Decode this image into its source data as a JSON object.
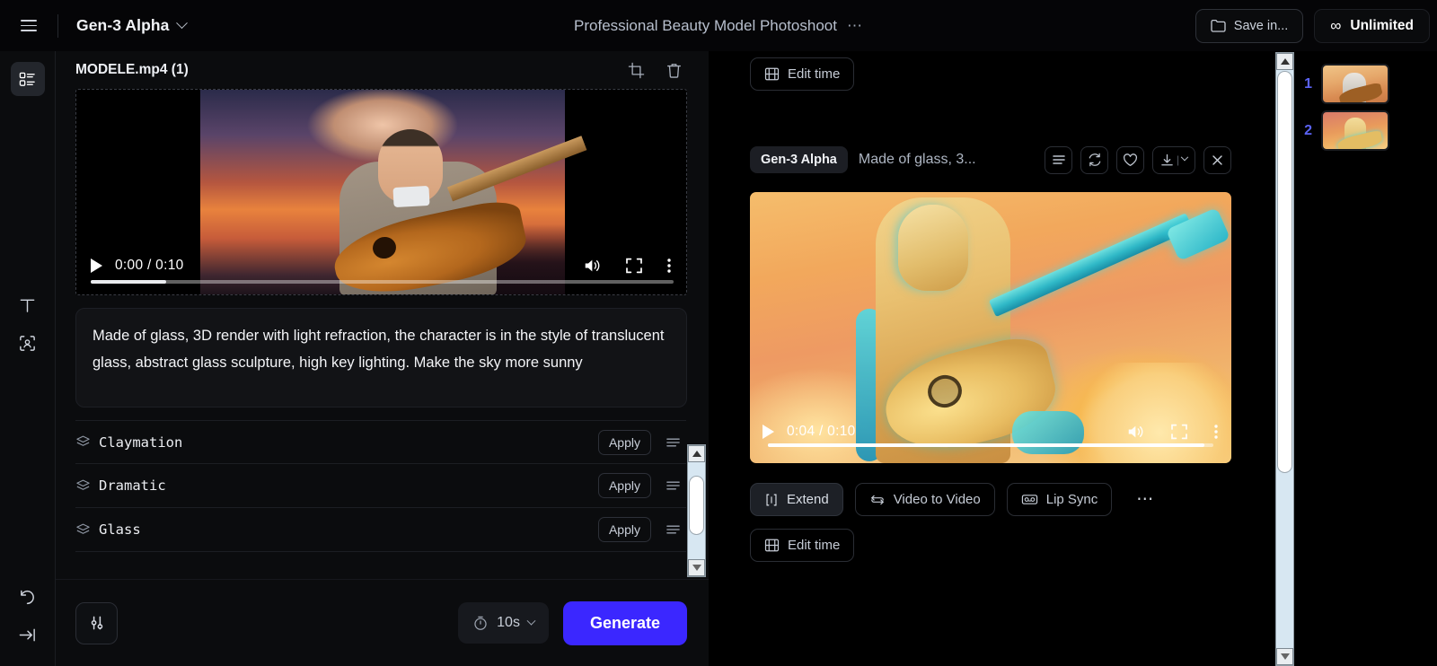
{
  "topbar": {
    "menu_icon": "hamburger-icon",
    "model_name": "Gen-3 Alpha",
    "project_title": "Professional Beauty Model Photoshoot",
    "project_more": "⋯",
    "save_in_label": "Save in...",
    "plan_label": "Unlimited",
    "plan_icon": "infinity-icon"
  },
  "rail": {
    "items": [
      {
        "name": "assets-panel",
        "icon": "list-grid-icon"
      },
      {
        "name": "text-tool",
        "icon": "text-T-icon"
      },
      {
        "name": "face-detect-tool",
        "icon": "face-scan-icon"
      },
      {
        "name": "history",
        "icon": "undo-rotate-icon"
      },
      {
        "name": "collapse-panel",
        "icon": "arrow-to-line-icon"
      }
    ]
  },
  "left_panel": {
    "asset_title": "MODELE.mp4 (1)",
    "crop_icon": "crop-icon",
    "delete_icon": "trash-icon",
    "video": {
      "current_time": "0:00",
      "duration": "0:10",
      "time_display": "0:00 / 0:10",
      "progress_percent": 13,
      "play_icon": "play-icon",
      "volume_icon": "volume-icon",
      "fullscreen_icon": "fullscreen-icon",
      "more_icon": "kebab-menu-icon"
    },
    "prompt": "Made of glass, 3D render with light refraction, the character  is in the style of translucent glass, abstract glass sculpture, high key lighting. Make the sky more sunny",
    "styles": [
      {
        "name": "Claymation",
        "apply_label": "Apply",
        "icon": "layers-icon",
        "menu_icon": "list-lines-icon"
      },
      {
        "name": "Dramatic",
        "apply_label": "Apply",
        "icon": "layers-icon",
        "menu_icon": "list-lines-icon"
      },
      {
        "name": "Glass",
        "apply_label": "Apply",
        "icon": "layers-icon",
        "menu_icon": "list-lines-icon"
      }
    ],
    "bottom": {
      "settings_icon": "sliders-icon",
      "duration_label": "10s",
      "duration_icon": "timer-icon",
      "generate_label": "Generate",
      "generate_color": "#3b27ff"
    }
  },
  "center_panel": {
    "edit_time_top_label": "Edit time",
    "edit_time_icon": "film-strip-icon",
    "generation": {
      "model_badge": "Gen-3 Alpha",
      "prompt_truncated": "Made of glass, 3...",
      "icons": [
        {
          "name": "details-list-icon"
        },
        {
          "name": "regenerate-icon"
        },
        {
          "name": "favorite-heart-icon"
        },
        {
          "name": "download-icon"
        },
        {
          "name": "close-icon"
        }
      ],
      "video": {
        "current_time": "0:04",
        "duration": "0:10",
        "time_display": "0:04 / 0:10",
        "progress_percent": 98,
        "play_icon": "play-icon",
        "volume_icon": "volume-icon",
        "fullscreen_icon": "fullscreen-icon",
        "more_icon": "kebab-menu-icon"
      },
      "actions": [
        {
          "label": "Extend",
          "icon": "extend-icon",
          "active": true
        },
        {
          "label": "Video to Video",
          "icon": "video-to-video-icon",
          "active": false
        },
        {
          "label": "Lip Sync",
          "icon": "lip-sync-icon",
          "active": false
        }
      ],
      "more_label": "⋯",
      "edit_time_label": "Edit time"
    }
  },
  "right_panel": {
    "thumbnails": [
      {
        "number": "1"
      },
      {
        "number": "2"
      }
    ]
  },
  "scrollbars": {
    "up_arrow": "triangle-up-icon",
    "down_arrow": "triangle-down-icon"
  }
}
